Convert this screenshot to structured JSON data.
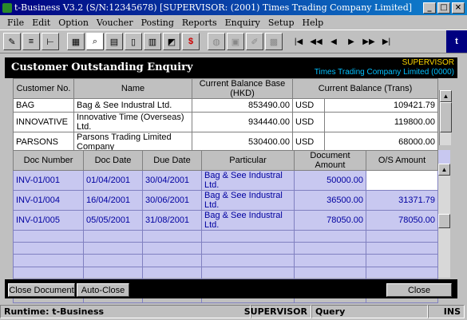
{
  "window": {
    "title": "t-Business V3.2 (S/N:12345678) [SUPERVISOR: (2001) Times Trading Company Limited]",
    "minimize": "_",
    "maximize": "□",
    "close": "×"
  },
  "menu": [
    "File",
    "Edit",
    "Option",
    "Voucher",
    "Posting",
    "Reports",
    "Enquiry",
    "Setup",
    "Help"
  ],
  "header": {
    "title": "Customer Outstanding Enquiry",
    "user": "SUPERVISOR",
    "company": "Times Trading Company Limited (0000)"
  },
  "customers": {
    "columns": [
      "Customer No.",
      "Name",
      "Current Balance Base (HKD)",
      "Current Balance (Trans)"
    ],
    "rows": [
      {
        "no": "BAG",
        "name": "Bag & See Industral Ltd.",
        "base": "853490.00",
        "cur": "USD",
        "trans": "109421.79"
      },
      {
        "no": "INNOVATIVE",
        "name": "Innovative Time (Overseas) Ltd.",
        "base": "934440.00",
        "cur": "USD",
        "trans": "119800.00"
      },
      {
        "no": "PARSONS",
        "name": "Parsons Trading Limited Company",
        "base": "530400.00",
        "cur": "USD",
        "trans": "68000.00"
      },
      {
        "no": "",
        "name": "",
        "base": "",
        "cur": "",
        "trans": ""
      }
    ]
  },
  "documents": {
    "columns": [
      "Doc Number",
      "Doc Date",
      "Due Date",
      "Particular",
      "Document Amount",
      "O/S Amount"
    ],
    "rows": [
      {
        "doc": "INV-01/001",
        "date": "01/04/2001",
        "due": "30/04/2001",
        "part": "Bag & See Industral Ltd.",
        "amt": "50000.00",
        "os": ""
      },
      {
        "doc": "INV-01/004",
        "date": "16/04/2001",
        "due": "30/06/2001",
        "part": "Bag & See Industral Ltd.",
        "amt": "36500.00",
        "os": "31371.79"
      },
      {
        "doc": "INV-01/005",
        "date": "05/05/2001",
        "due": "31/08/2001",
        "part": "Bag & See Industral Ltd.",
        "amt": "78050.00",
        "os": "78050.00"
      }
    ]
  },
  "buttons": {
    "close_document": "Close Document",
    "auto_close": "Auto-Close",
    "close": "Close"
  },
  "status": {
    "runtime": "Runtime: t-Business",
    "user": "SUPERVISOR",
    "mode": "Query",
    "ins": "INS"
  }
}
